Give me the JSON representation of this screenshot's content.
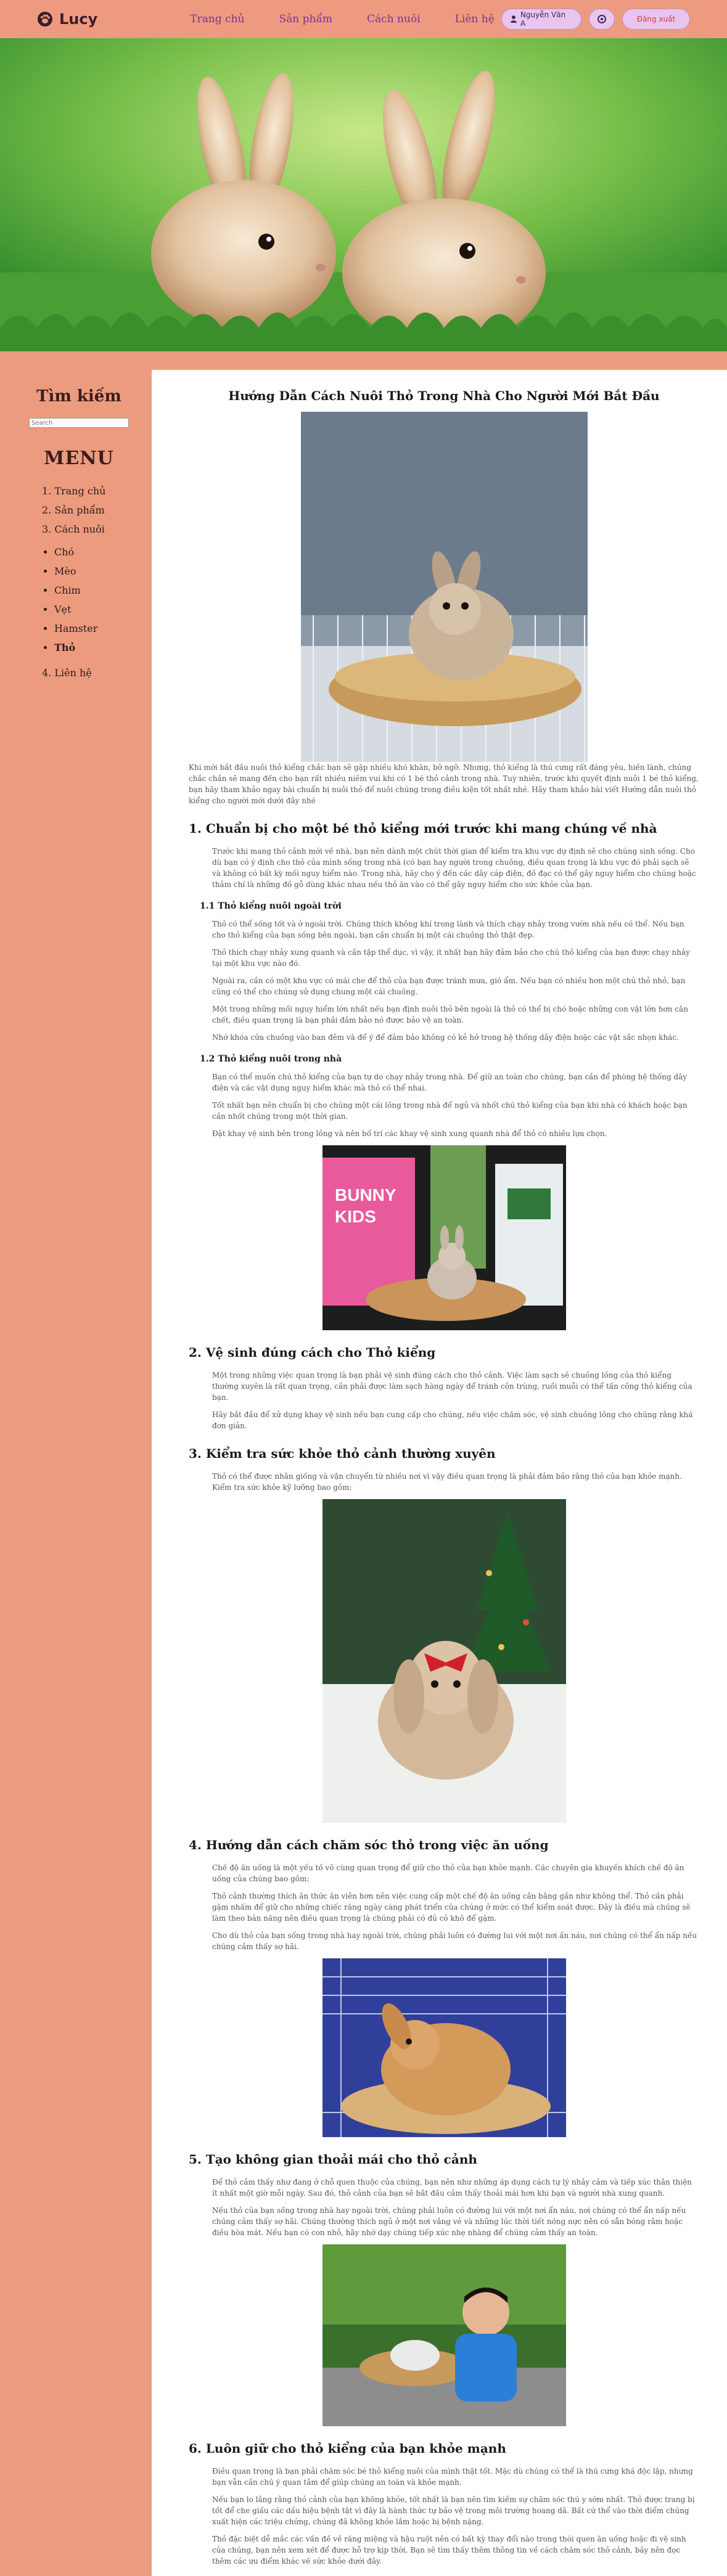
{
  "brand": {
    "name": "Lucy"
  },
  "nav": {
    "links": [
      "Trang chủ",
      "Sản phẩm",
      "Cách nuôi",
      "Liên hệ"
    ]
  },
  "account": {
    "user": "Nguyễn Văn A",
    "logout": "Đăng xuất"
  },
  "sidebar": {
    "search_title": "Tìm kiếm",
    "search_placeholder": "Search",
    "menu_title": "MENU",
    "items": [
      "Trang chủ",
      "Sản phẩm",
      "Cách nuôi",
      "Liên hệ"
    ],
    "subitems": [
      "Chó",
      "Mèo",
      "Chim",
      "Vẹt",
      "Hamster",
      "Thỏ"
    ]
  },
  "article": {
    "title": "Hướng Dẫn Cách Nuôi Thỏ Trong Nhà Cho Người Mới Bắt Đầu",
    "intro": "Khi mới bắt đầu nuôi thỏ kiểng chắc bạn sẽ gặp nhiều khó khăn, bỡ ngỡ. Nhưng, thỏ kiểng là thú cưng rất đáng yêu, hiền lành, chúng chắc chắn sẽ mang đến cho bạn rất nhiều niềm vui khi có 1 bé thỏ cảnh trong nhà. Tuy nhiên, trước khi quyết định nuôi 1 bé thỏ kiểng, bạn hãy tham khảo ngay bài chuẩn bị nuôi thỏ để nuôi chúng trong điều kiện tốt nhất nhé. Hãy tham khảo bài viết Hướng dẫn nuôi thỏ kiểng cho người mới dưới đây nhé",
    "s1": {
      "title": "1. Chuẩn bị cho một bé thỏ kiểng mới trước khi mang chúng về nhà",
      "p1": "Trước khi mang thỏ cảnh mới về nhà, bạn nên dành một chút thời gian để kiểm tra khu vực dự định sẽ cho chúng sinh sống. Cho dù bạn có ý định cho thỏ của mình sống trong nhà (có bạn hay người trong chuồng, điều quan trọng là khu vực đó phải sạch sẽ và không có bất kỳ mối nguy hiểm nào. Trong nhà, hãy cho ý đến các dây cáp điện, đồ đạc có thể gây nguy hiểm cho chúng hoặc thảm chí là những đồ gỗ dùng khác nhau nếu thỏ ăn vào có thể gây nguy hiểm cho sức khỏe của bạn.",
      "sub1": "1.1 Thỏ kiểng nuôi ngoài trời",
      "sub1_p": [
        "Thỏ có thể sống tốt và ở ngoài trời. Chúng thích không khí trong lành và thích chạy nhảy trong vườn nhà nếu có thể. Nếu bạn cho thỏ kiểng của bạn sống bên ngoài, bạn cần chuẩn bị một cái chuồng thỏ thật đẹp.",
        "Thỏ thích chạy nhảy xung quanh và cần tập thể dục, vì vậy, ít nhất bạn hãy đảm bảo cho chú thỏ kiểng của bạn được chạy nhảy tại một khu vực nào đó.",
        "Ngoài ra, cần có một khu vực có mái che để thỏ của bạn được tránh mưa, gió ẩm. Nếu bạn có nhiều hơn một chú thỏ nhỏ, bạn cũng có thể cho chúng sử dụng chung một cái chuồng.",
        "Một trong những mối nguy hiểm lớn nhất nếu bạn định nuôi thỏ bên ngoài là thỏ có thể bị chó hoặc những con vật lớn hơn cắn chết, điều quan trọng là bạn phải đảm bảo nó được bảo vệ an toàn.",
        "Nhớ khóa cửa chuồng vào ban đêm và để ý để đảm bảo không có kẻ hở trong hệ thống dây điện hoặc các vật sắc nhọn khác."
      ],
      "sub2": "1.2 Thỏ kiểng nuôi trong nhà",
      "sub2_p": [
        "Bạn có thể muốn chú thỏ kiểng của bạn tự do chạy nhảy trong nhà. Để giữ an toàn cho chúng, bạn cần để phòng hệ thống dây điện và các vật dụng nguy hiểm khác mà thỏ có thể nhai.",
        "Tốt nhất bạn nên chuẩn bị cho chúng một cái lồng trong nhà để ngủ và nhốt chú thỏ kiểng của bạn khi nhà có khách hoặc bạn cần nhốt chúng trong một thời gian.",
        "Đặt khay vệ sinh bên trong lồng và nên bố trí các khay vệ sinh xung quanh nhà để thỏ có nhiều lựa chọn."
      ]
    },
    "s2": {
      "title": "2. Vệ sinh đúng cách cho Thỏ kiểng",
      "p": [
        "Một trong những việc quan trọng là bạn phải vệ sinh đúng cách cho thỏ cảnh. Việc làm sạch sẽ chuồng lồng của thỏ kiểng thường xuyên là rất quan trọng, cần phải được làm sạch hàng ngày để tránh côn trùng, ruồi muỗi có thể tấn công thỏ kiểng của bạn.",
        "Hãy bắt đầu để xử dụng khay vệ sinh nếu bạn cung cấp cho chúng, nếu việc chăm sóc, vệ sinh chuồng lồng cho chúng rằng khá đơn giản."
      ]
    },
    "s3": {
      "title": "3. Kiểm tra sức khỏe thỏ cảnh thường xuyên",
      "p": "Thỏ có thể được nhân giống và vận chuyển từ nhiều nơi vì vậy điều quan trọng là phải đảm bảo rằng thỏ của bạn khỏe mạnh. Kiểm tra sức khỏe kỹ lưỡng bao gồm:"
    },
    "s4": {
      "title": "4. Hướng dẫn cách chăm sóc thỏ trong việc ăn uống",
      "p": [
        "Chế độ ăn uống là một yếu tố vô cùng quan trọng để giữ cho thỏ của bạn khỏe mạnh. Các chuyên gia khuyến khích chế độ ăn uống của chúng bao gồm:",
        "Thỏ cảnh thường thích ăn thức ăn viên hơn nên việc cung cấp một chế độ ăn uống cân bằng gần như không thể. Thỏ cần phải gặm nhấm để giữ cho những chiếc răng ngày càng phát triển của chúng ở mức có thể kiểm soát được. Đây là điều mà chúng sẽ làm theo bản năng nên điều quan trọng là chúng phải có đủ cỏ khô để gặm.",
        "Cho dù thỏ của bạn sống trong nhà hay ngoài trời, chúng phải luôn có đường lui với một nơi ấn náu, nơi chúng có thể ẩn nấp nếu chúng cảm thấy sợ hãi."
      ]
    },
    "s5": {
      "title": "5. Tạo không gian thoải mái cho thỏ cảnh",
      "p": [
        "Để thỏ cảm thấy như đang ở chỗ quen thuộc của chúng, bạn nên như những áp dụng cách tự lý nhảy cảm và tiếp xúc thân thiện ít nhất một giờ mỗi ngày. Sau đó, thỏ cảnh của bạn sẽ bắt đầu cảm thấy thoải mái hơn khi bạn và người nhà xung quanh.",
        "Nếu thỏ của bạn sống trong nhà hay ngoài trời, chúng phải luôn có đường lui với một nơi ẩn náu, nơi chúng có thể ẩn nấp nếu chúng cảm thấy sợ hãi. Chúng thường thích ngủ ở một nơi vắng vẻ và những lúc thời tiết nóng nực nên có sẵn bóng râm hoặc điều hòa mát. Nếu bạn có con nhỏ, hãy nhớ dạy chúng tiếp xúc nhẹ nhàng để chúng cảm thấy an toàn."
      ]
    },
    "s6": {
      "title": "6. Luôn giữ cho thỏ kiểng của bạn khỏe mạnh",
      "p": [
        "Điều quan trọng là bạn phải chăm sóc bé thỏ kiểng nuôi của mình thật tốt. Mặc dù chúng có thể là thú cưng khá độc lập, nhưng bạn vẫn cần chú ý quan tâm để giúp chúng an toàn và khỏe mạnh.",
        "Nếu bạn lo lắng rằng thỏ cảnh của bạn không khỏe, tốt nhất là bạn nên tìm kiếm sự chăm sóc thú y sớm nhất. Thỏ được trang bị tốt để che giấu các dấu hiệu bệnh tật vì đây là hành thức tự bảo vệ trong môi trường hoang dã. Bất cứ thể vào thời điểm chúng xuất hiện các triệu chứng, chúng đã không khỏe lắm hoặc bị bệnh nặng.",
        "Thỏ đặc biệt dễ mắc các vấn đề về răng miệng và hậu ruột nên có bất kỳ thay đổi nào trong thói quen ăn uống hoặc đi vệ sinh của chúng, bạn nên xem xét để được hỗ trợ kịp thời. Bạn sẽ tìm thấy thêm thông tin về cách chăm sóc thỏ cảnh, bảy nên đọc thêm các ưu điểm khác về sức khỏe dưới đây."
      ]
    }
  }
}
